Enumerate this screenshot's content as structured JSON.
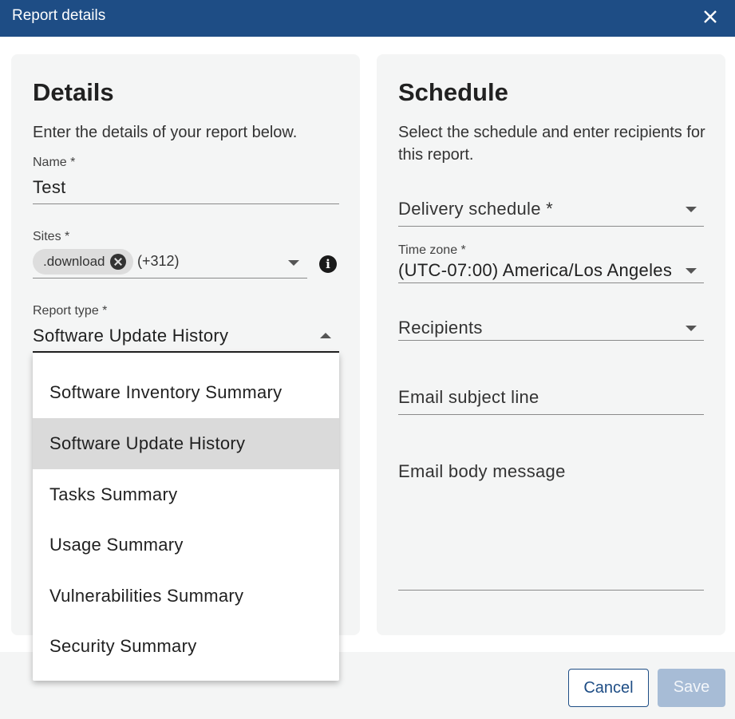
{
  "dialog": {
    "title": "Report details"
  },
  "details": {
    "heading": "Details",
    "description": "Enter the details of your report below.",
    "name": {
      "label": "Name *",
      "value": "Test"
    },
    "sites": {
      "label": "Sites *",
      "chip": ".download",
      "more": "(+312)"
    },
    "report_type": {
      "label": "Report type *",
      "value": "Software Update History"
    }
  },
  "schedule": {
    "heading": "Schedule",
    "description_line1": "Select the schedule and enter recipients for",
    "description_line2": "this report.",
    "delivery_schedule": {
      "placeholder": "Delivery schedule *"
    },
    "time_zone": {
      "label": "Time zone *",
      "value": "(UTC-07:00) America/Los Angeles"
    },
    "recipients": {
      "placeholder": "Recipients"
    },
    "email_subject": {
      "placeholder": "Email subject line"
    },
    "email_body": {
      "placeholder": "Email body message"
    }
  },
  "report_type_options": [
    {
      "label": "Software Inventory Summary",
      "selected": false
    },
    {
      "label": "Software Update History",
      "selected": true
    },
    {
      "label": "Tasks Summary",
      "selected": false
    },
    {
      "label": "Usage Summary",
      "selected": false
    },
    {
      "label": "Vulnerabilities Summary",
      "selected": false
    },
    {
      "label": "Security Summary",
      "selected": false
    }
  ],
  "footer": {
    "cancel_label": "Cancel",
    "save_label": "Save"
  },
  "colors": {
    "titlebar": "#1e4d85",
    "panel": "#f4f5f5",
    "selected_option": "#dadada",
    "save_disabled": "#a7bcd6"
  },
  "icons": {
    "close": "close-icon",
    "info": "info-icon",
    "chip_remove": "cancel-circle-icon",
    "dropdown": "caret-icon"
  }
}
